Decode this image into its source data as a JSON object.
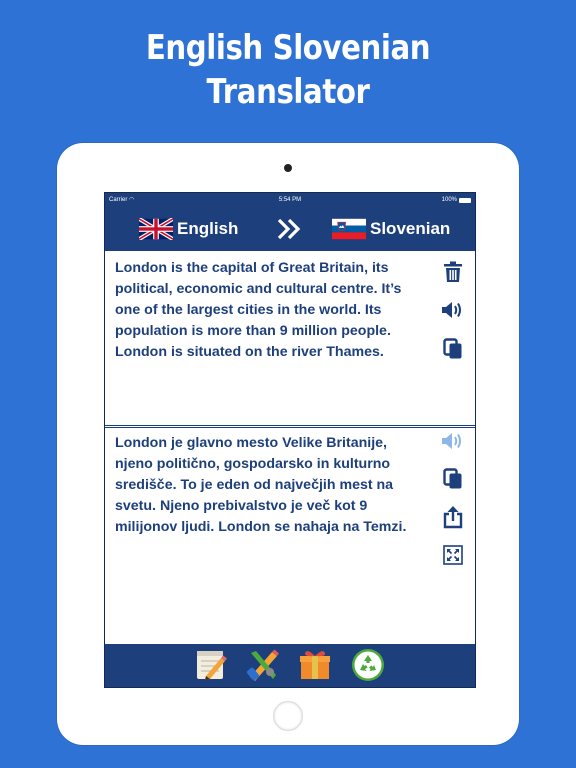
{
  "headline": {
    "line1": "English Slovenian",
    "line2": "Translator"
  },
  "status_bar": {
    "carrier": "Carrier",
    "time": "5:54 PM",
    "battery": "100%"
  },
  "language_bar": {
    "source_language": "English",
    "target_language": "Slovenian",
    "source_flag": "uk-flag-icon",
    "target_flag": "slovenia-flag-icon",
    "swap_icon": "double-chevron-right-icon"
  },
  "source_pane": {
    "text": "London is the capital of Great Britain, its political, economic and cultural centre. It’s one of the largest cities in the world. Its population is more than 9 million people. London is situated on the river Thames.",
    "tools": [
      "trash-icon",
      "speaker-icon",
      "copy-icon"
    ]
  },
  "target_pane": {
    "text": "London je glavno mesto Velike Britanije, njeno politično, gospodarsko in kulturno središče. To je eden od največjih mest na svetu. Njeno prebivalstvo je več kot 9 milijonov ljudi. London se nahaja na Temzi.",
    "tools": [
      "speaker-icon",
      "copy-icon",
      "share-icon",
      "fullscreen-icon"
    ]
  },
  "bottom_toolbar": {
    "buttons": [
      "notepad-pencil-icon",
      "tools-icon",
      "gift-icon",
      "recycle-icon"
    ]
  },
  "colors": {
    "background": "#2f72d6",
    "navy": "#1d3f7c",
    "speaker_disabled": "#8fb6e8",
    "recycle_green": "#4caa3c"
  }
}
